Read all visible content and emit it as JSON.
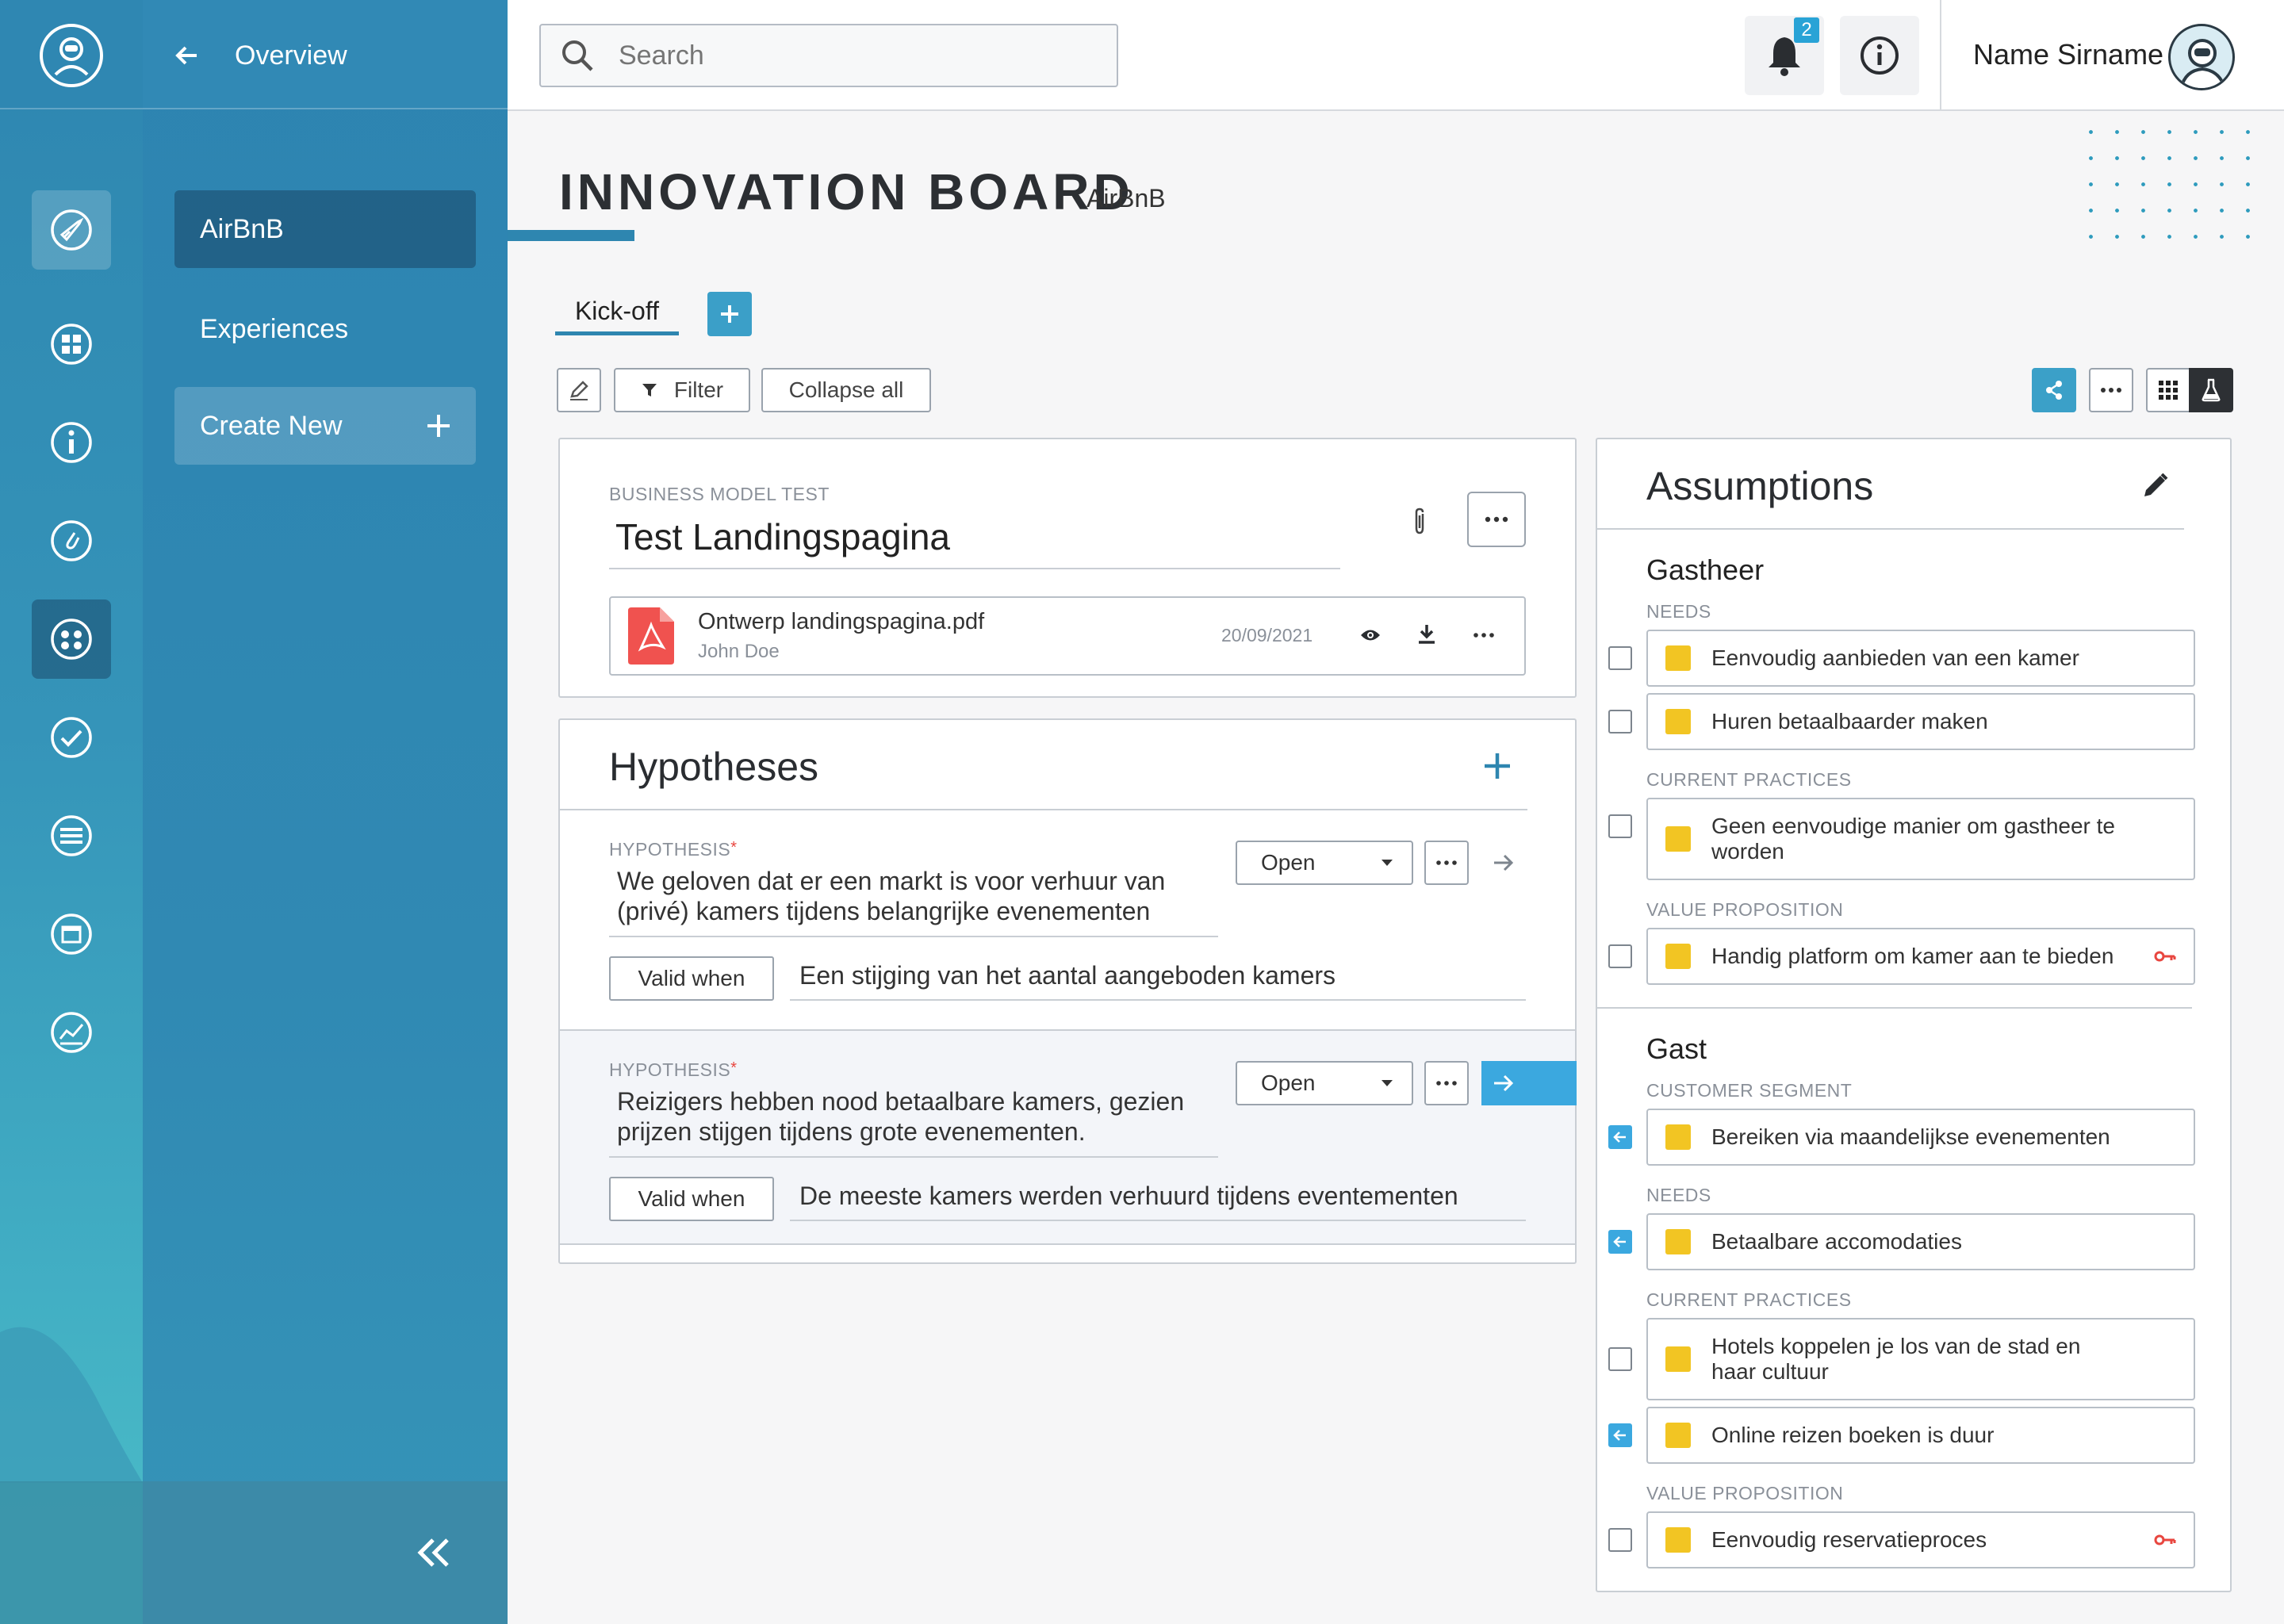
{
  "nav": {
    "back_label": "Overview",
    "items": [
      {
        "label": "AirBnB"
      },
      {
        "label": "Experiences"
      },
      {
        "label": "Create New"
      }
    ]
  },
  "header": {
    "search_placeholder": "Search",
    "notification_count": "2",
    "user_name": "Name Sirname"
  },
  "page": {
    "title": "INNOVATION BOARD",
    "subtitle": "AirBnB",
    "tabs": [
      {
        "label": "Kick-off"
      }
    ]
  },
  "toolbar": {
    "filter_label": "Filter",
    "collapse_label": "Collapse all"
  },
  "test_card": {
    "category": "BUSINESS MODEL TEST",
    "title": "Test Landingspagina",
    "file": {
      "name": "Ontwerp landingspagina.pdf",
      "author": "John Doe",
      "date": "20/09/2021"
    }
  },
  "hypotheses": {
    "title": "Hypotheses",
    "items": [
      {
        "label": "HYPOTHESIS",
        "required": "*",
        "text_line1": "We geloven dat er een markt is voor verhuur van",
        "text_line2": "(privé) kamers tijdens belangrijke evenementen",
        "status": "Open",
        "valid_label": "Valid when",
        "valid_text": "Een stijging van het aantal aangeboden kamers"
      },
      {
        "label": "HYPOTHESIS",
        "required": "*",
        "text_line1": "Reizigers hebben nood betaalbare kamers, gezien",
        "text_line2": "prijzen stijgen tijdens grote evenementen.",
        "status": "Open",
        "valid_label": "Valid when",
        "valid_text": "De meeste kamers werden verhuurd tijdens eventementen"
      }
    ]
  },
  "assumptions": {
    "title": "Assumptions",
    "groups": [
      {
        "name": "Gastheer",
        "sections": [
          {
            "category": "NEEDS",
            "items": [
              "Eenvoudig aanbieden van een kamer",
              "Huren betaalbaarder maken"
            ]
          },
          {
            "category": "CURRENT PRACTICES",
            "items": [
              "Geen eenvoudige manier om gastheer te worden"
            ]
          },
          {
            "category": "VALUE PROPOSITION",
            "items": [
              "Handig platform om kamer aan te bieden"
            ]
          }
        ]
      },
      {
        "name": "Gast",
        "sections": [
          {
            "category": "CUSTOMER SEGMENT",
            "items": [
              "Bereiken via maandelijkse evenementen"
            ]
          },
          {
            "category": "NEEDS",
            "items": [
              "Betaalbare accomodaties"
            ]
          },
          {
            "category": "CURRENT PRACTICES",
            "items": [
              "Hotels koppelen je los van de stad en haar cultuur",
              "Online reizen boeken is duur"
            ]
          },
          {
            "category": "VALUE PROPOSITION",
            "items": [
              "Eenvoudig reservatieproces"
            ]
          }
        ]
      }
    ]
  },
  "colors": {
    "primary": "#2e86b0",
    "accent": "#3ba8df",
    "sticky_yellow": "#f2c523",
    "key_red": "#e8463f",
    "pdf_red": "#f0524f"
  }
}
